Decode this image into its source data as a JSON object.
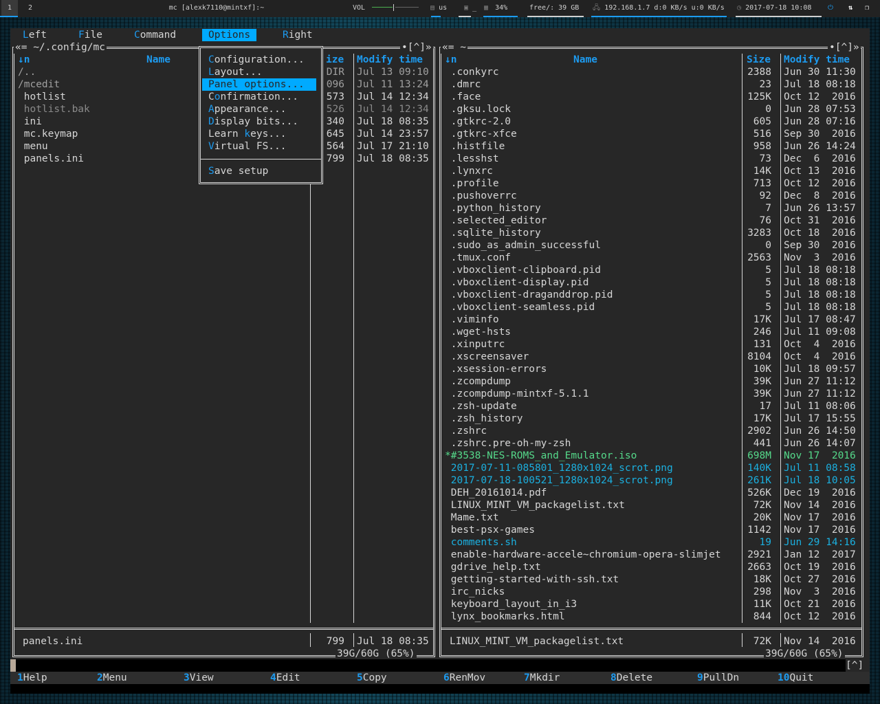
{
  "topbar": {
    "workspaces": [
      {
        "label": "1",
        "active": true
      },
      {
        "label": "2",
        "active": false
      }
    ],
    "window_title": "mc [alexk7110@mintxf]:~",
    "volume_label": "VOL",
    "keyboard_layout": "us",
    "caps_indicator": "_",
    "cpu_usage": "34%",
    "disk_free": "free/: 39 GB",
    "network": "192.168.1.7 d:0 KB/s u:0 KB/s",
    "datetime": "2017-07-18 10:08"
  },
  "menubar": {
    "items": [
      {
        "hotkey": "L",
        "rest": "eft",
        "selected": false
      },
      {
        "hotkey": "F",
        "rest": "ile",
        "selected": false
      },
      {
        "hotkey": "C",
        "rest": "ommand",
        "selected": false
      },
      {
        "hotkey": "O",
        "rest": "ptions",
        "selected": true
      },
      {
        "hotkey": "R",
        "rest": "ight",
        "selected": false
      }
    ]
  },
  "options_menu": {
    "items": [
      {
        "pre": "",
        "hotkey": "C",
        "rest": "onfiguration...",
        "selected": false
      },
      {
        "pre": "",
        "hotkey": "L",
        "rest": "ayout...",
        "selected": false
      },
      {
        "pre": "",
        "hotkey": "P",
        "rest": "anel options...",
        "selected": true
      },
      {
        "pre": "C",
        "hotkey": "o",
        "rest": "nfirmation...",
        "selected": false
      },
      {
        "pre": "",
        "hotkey": "A",
        "rest": "ppearance...",
        "selected": false
      },
      {
        "pre": "",
        "hotkey": "D",
        "rest": "isplay bits...",
        "selected": false
      },
      {
        "pre": "Learn ",
        "hotkey": "k",
        "rest": "eys...",
        "selected": false
      },
      {
        "pre": "",
        "hotkey": "V",
        "rest": "irtual FS...",
        "selected": false
      }
    ],
    "save_item": {
      "hotkey": "S",
      "rest": "ave setup"
    }
  },
  "left_panel": {
    "path": "«= ~/.config/mc",
    "corner": "•[^]»",
    "sort_indicator": "↓n",
    "headers": {
      "name": "Name",
      "size": "ize",
      "modify": "Modify time"
    },
    "files": [
      {
        "name": "/..",
        "size": "DIR",
        "date": "Jul 13 09:10",
        "style": "grey"
      },
      {
        "name": "/mcedit",
        "size": "096",
        "date": "Jul 11 13:24",
        "style": "grey"
      },
      {
        "name": " hotlist",
        "size": "573",
        "date": "Jul 14 12:34",
        "style": "fg"
      },
      {
        "name": " hotlist.bak",
        "size": "526",
        "date": "Jul 14 12:34",
        "style": "dim"
      },
      {
        "name": " ini",
        "size": "340",
        "date": "Jul 18 08:35",
        "style": "fg"
      },
      {
        "name": " mc.keymap",
        "size": "645",
        "date": "Jul 14 23:57",
        "style": "fg"
      },
      {
        "name": " menu",
        "size": "564",
        "date": "Jul 17 21:10",
        "style": "fg"
      },
      {
        "name": " panels.ini",
        "size": "799",
        "date": "Jul 18 08:35",
        "style": "fg"
      }
    ],
    "status": {
      "name": "panels.ini",
      "size": "799",
      "date": "Jul 18 08:35"
    },
    "disk": "39G/60G (65%)"
  },
  "right_panel": {
    "path": "«= ~",
    "corner": "•[^]»",
    "sort_indicator": "↓n",
    "headers": {
      "name": "Name",
      "size": "Size",
      "modify": "Modify time"
    },
    "files": [
      {
        "name": " .conkyrc",
        "size": "2388",
        "date": "Jun 30 11:30",
        "style": "fg"
      },
      {
        "name": " .dmrc",
        "size": "23",
        "date": "Jul 18 08:18",
        "style": "fg"
      },
      {
        "name": " .face",
        "size": "125K",
        "date": "Oct 12  2016",
        "style": "fg"
      },
      {
        "name": " .gksu.lock",
        "size": "0",
        "date": "Jun 28 07:53",
        "style": "fg"
      },
      {
        "name": " .gtkrc-2.0",
        "size": "605",
        "date": "Jun 28 07:16",
        "style": "fg"
      },
      {
        "name": " .gtkrc-xfce",
        "size": "516",
        "date": "Sep 30  2016",
        "style": "fg"
      },
      {
        "name": " .histfile",
        "size": "958",
        "date": "Jun 26 14:24",
        "style": "fg"
      },
      {
        "name": " .lesshst",
        "size": "73",
        "date": "Dec  6  2016",
        "style": "fg"
      },
      {
        "name": " .lynxrc",
        "size": "14K",
        "date": "Oct 13  2016",
        "style": "fg"
      },
      {
        "name": " .profile",
        "size": "713",
        "date": "Oct 12  2016",
        "style": "fg"
      },
      {
        "name": " .pushoverrc",
        "size": "92",
        "date": "Dec  8  2016",
        "style": "fg"
      },
      {
        "name": " .python_history",
        "size": "7",
        "date": "Jun 26 13:57",
        "style": "fg"
      },
      {
        "name": " .selected_editor",
        "size": "76",
        "date": "Oct 31  2016",
        "style": "fg"
      },
      {
        "name": " .sqlite_history",
        "size": "3283",
        "date": "Oct 18  2016",
        "style": "fg"
      },
      {
        "name": " .sudo_as_admin_successful",
        "size": "0",
        "date": "Sep 30  2016",
        "style": "fg"
      },
      {
        "name": " .tmux.conf",
        "size": "2563",
        "date": "Nov  3  2016",
        "style": "fg"
      },
      {
        "name": " .vboxclient-clipboard.pid",
        "size": "5",
        "date": "Jul 18 08:18",
        "style": "fg"
      },
      {
        "name": " .vboxclient-display.pid",
        "size": "5",
        "date": "Jul 18 08:18",
        "style": "fg"
      },
      {
        "name": " .vboxclient-draganddrop.pid",
        "size": "5",
        "date": "Jul 18 08:18",
        "style": "fg"
      },
      {
        "name": " .vboxclient-seamless.pid",
        "size": "5",
        "date": "Jul 18 08:18",
        "style": "fg"
      },
      {
        "name": " .viminfo",
        "size": "17K",
        "date": "Jul 17 08:47",
        "style": "fg"
      },
      {
        "name": " .wget-hsts",
        "size": "246",
        "date": "Jul 11 09:08",
        "style": "fg"
      },
      {
        "name": " .xinputrc",
        "size": "131",
        "date": "Oct  4  2016",
        "style": "fg"
      },
      {
        "name": " .xscreensaver",
        "size": "8104",
        "date": "Oct  4  2016",
        "style": "fg"
      },
      {
        "name": " .xsession-errors",
        "size": "10K",
        "date": "Jul 18 09:57",
        "style": "fg"
      },
      {
        "name": " .zcompdump",
        "size": "39K",
        "date": "Jun 27 11:12",
        "style": "fg"
      },
      {
        "name": " .zcompdump-mintxf-5.1.1",
        "size": "39K",
        "date": "Jun 27 11:12",
        "style": "fg"
      },
      {
        "name": " .zsh-update",
        "size": "17",
        "date": "Jul 11 08:06",
        "style": "fg"
      },
      {
        "name": " .zsh_history",
        "size": "17K",
        "date": "Jul 17 15:55",
        "style": "fg"
      },
      {
        "name": " .zshrc",
        "size": "2902",
        "date": "Jun 26 14:50",
        "style": "fg"
      },
      {
        "name": " .zshrc.pre-oh-my-zsh",
        "size": "441",
        "date": "Jun 26 14:07",
        "style": "fg"
      },
      {
        "name": "*#3538-NES-ROMS_and_Emulator.iso",
        "size": "698M",
        "date": "Nov 17  2016",
        "style": "exe"
      },
      {
        "name": " 2017-07-11-085801_1280x1024_scrot.png",
        "size": "140K",
        "date": "Jul 11 08:58",
        "style": "img"
      },
      {
        "name": " 2017-07-18-100521_1280x1024_scrot.png",
        "size": "261K",
        "date": "Jul 18 10:05",
        "style": "img"
      },
      {
        "name": " DEH_20161014.pdf",
        "size": "526K",
        "date": "Dec 19  2016",
        "style": "fg"
      },
      {
        "name": " LINUX_MINT_VM_packagelist.txt",
        "size": "72K",
        "date": "Nov 14  2016",
        "style": "fg"
      },
      {
        "name": " Mame.txt",
        "size": "20K",
        "date": "Nov 17  2016",
        "style": "fg"
      },
      {
        "name": " best-psx-games",
        "size": "1142",
        "date": "Nov 17  2016",
        "style": "fg"
      },
      {
        "name": " comments.sh",
        "size": "19",
        "date": "Jun 29 14:16",
        "style": "sh"
      },
      {
        "name": " enable-hardware-accele~chromium-opera-slimjet",
        "size": "2921",
        "date": "Jan 12  2017",
        "style": "fg"
      },
      {
        "name": " gdrive_help.txt",
        "size": "2663",
        "date": "Oct 19  2016",
        "style": "fg"
      },
      {
        "name": " getting-started-with-ssh.txt",
        "size": "18K",
        "date": "Oct 27  2016",
        "style": "fg"
      },
      {
        "name": " irc_nicks",
        "size": "298",
        "date": "Nov  3  2016",
        "style": "fg"
      },
      {
        "name": " keyboard_layout_in_i3",
        "size": "11K",
        "date": "Oct 21  2016",
        "style": "fg"
      },
      {
        "name": " lynx_bookmarks.html",
        "size": "844",
        "date": "Oct 12  2016",
        "style": "fg"
      }
    ],
    "status": {
      "name": "LINUX_MINT_VM_packagelist.txt",
      "size": "72K",
      "date": "Nov 14  2016"
    },
    "disk": "39G/60G (65%)"
  },
  "command_line": {
    "value": "",
    "history_button": "[^]"
  },
  "function_keys": [
    {
      "num": "1",
      "label": "Help"
    },
    {
      "num": "2",
      "label": "Menu"
    },
    {
      "num": "3",
      "label": "View"
    },
    {
      "num": "4",
      "label": "Edit"
    },
    {
      "num": "5",
      "label": "Copy"
    },
    {
      "num": "6",
      "label": "RenMov"
    },
    {
      "num": "7",
      "label": "Mkdir"
    },
    {
      "num": "8",
      "label": "Delete"
    },
    {
      "num": "9",
      "label": "PullDn"
    },
    {
      "num": "10",
      "label": "Quit"
    }
  ]
}
